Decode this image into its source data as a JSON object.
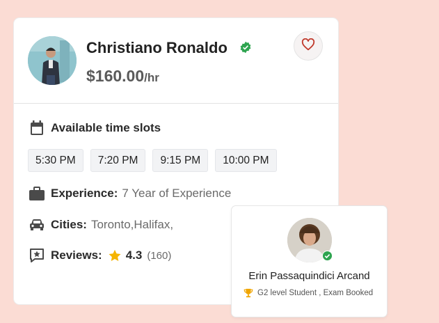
{
  "profile": {
    "name": "Christiano Ronaldo",
    "price": "$160.00",
    "price_unit": "/hr"
  },
  "slots_section": {
    "title": "Available time slots",
    "slots": [
      "5:30 PM",
      "7:20 PM",
      "9:15 PM",
      "10:00 PM"
    ]
  },
  "experience": {
    "label": "Experience:",
    "value": "7 Year of Experience"
  },
  "cities": {
    "label": "Cities:",
    "value": "Toronto,Halifax,"
  },
  "reviews": {
    "label": "Reviews:",
    "rating": "4.3",
    "count": "(160)"
  },
  "popup": {
    "name": "Erin Passaquindici Arcand",
    "subtitle": "G2 level Student , Exam Booked"
  },
  "colors": {
    "background": "#fbdcd4",
    "verified": "#2ea44f",
    "heart": "#c0392b",
    "star": "#f5b400",
    "icon": "#4a4a4a"
  },
  "icons": {
    "verified": "verified-badge-icon",
    "favorite": "heart-icon",
    "slots": "calendar-icon",
    "experience": "briefcase-icon",
    "cities": "car-icon",
    "reviews": "star-review-icon",
    "rating": "star-icon",
    "popup_sub": "trophy-icon"
  }
}
